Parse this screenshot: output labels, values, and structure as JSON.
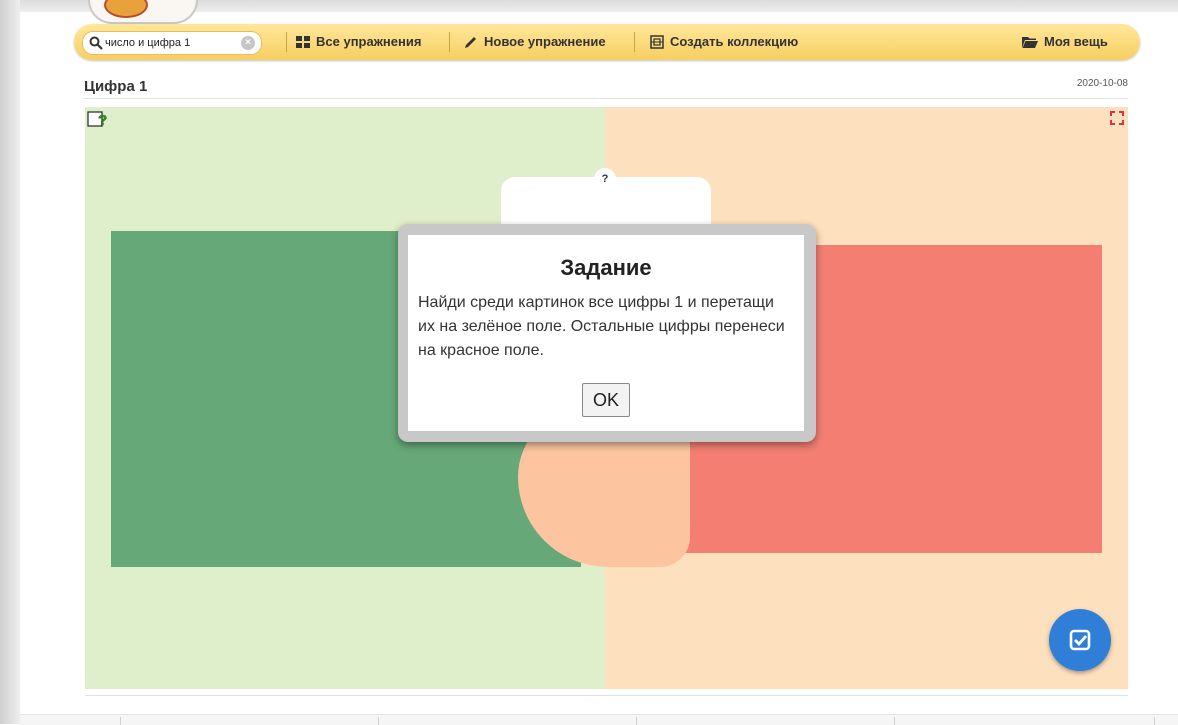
{
  "toolbar": {
    "search_value": "число и цифра 1",
    "all_exercises": "Все упражнения",
    "new_exercise": "Новое упражнение",
    "create_collection": "Создать коллекцию",
    "my_stuff": "Моя вещь"
  },
  "page": {
    "title": "Цифра 1",
    "date": "2020-10-08"
  },
  "game": {
    "tab_marker": "?",
    "colors": {
      "left_bg": "#dfeecb",
      "right_bg": "#fde0bd",
      "green_field": "#66a878",
      "red_field": "#f47e72",
      "check_button": "#2f7fd8"
    },
    "icons": [
      "help-icon",
      "fullscreen-icon",
      "check-icon"
    ]
  },
  "modal": {
    "title": "Задание",
    "text": "Найди среди картинок все цифры 1 и перетащи их на зелёное поле. Остальные цифры перенеси на красное поле.",
    "ok": "OK"
  }
}
